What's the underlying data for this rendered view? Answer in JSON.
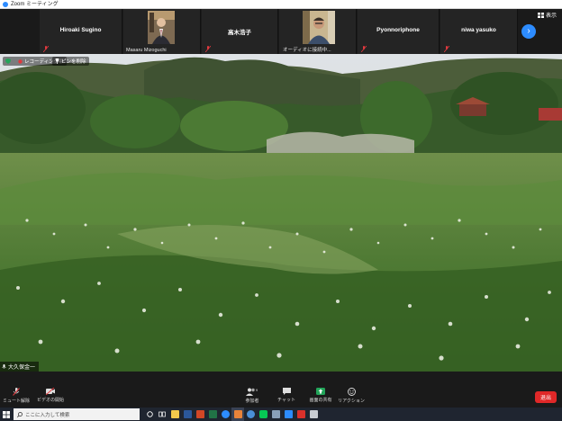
{
  "window": {
    "title": "Zoom ミーティング"
  },
  "gallery": {
    "participants": [
      {
        "name": "Hiroaki Sugino",
        "muted": true
      },
      {
        "name": "Masaru Mizoguchi",
        "muted": false,
        "has_video": true
      },
      {
        "name": "高木浩子",
        "muted": true
      },
      {
        "name": "オーディオに接続中...",
        "muted": false,
        "has_video": true
      },
      {
        "name": "Pyonnoriphone",
        "muted": true
      },
      {
        "name": "niwa yasuko",
        "muted": true
      }
    ],
    "view_label": "表示",
    "next_icon": "chevron-right-icon"
  },
  "video": {
    "recording_label": "レコーディング中",
    "unpin_label": "ピンを削除",
    "speaker_name": "大久保金一"
  },
  "controls": {
    "items": [
      {
        "label": "ミュート解除",
        "icon": "mic-muted-icon"
      },
      {
        "label": "ビデオの開始",
        "icon": "video-off-icon"
      },
      {
        "label": "参加者",
        "icon": "participants-icon",
        "count": "9"
      },
      {
        "label": "チャット",
        "icon": "chat-icon"
      },
      {
        "label": "画面の共有",
        "icon": "share-screen-icon"
      },
      {
        "label": "リアクション",
        "icon": "reaction-icon"
      }
    ],
    "end_label": "退出"
  },
  "taskbar": {
    "search_placeholder": "ここに入力して検索"
  },
  "colors": {
    "accent": "#2d8cff",
    "share_green": "#23a55a",
    "end_red": "#e02828",
    "muted_red": "#e0393e"
  }
}
